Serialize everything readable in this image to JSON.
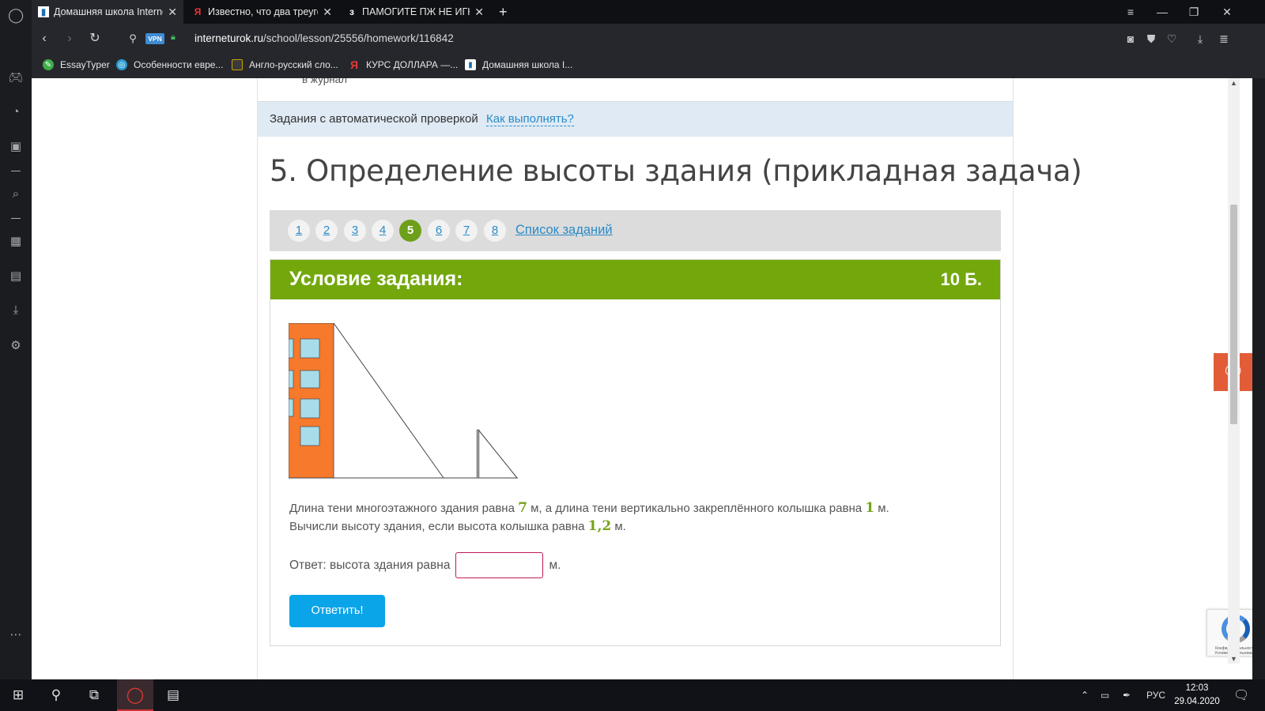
{
  "browser": {
    "tabs": [
      {
        "title": "Домашняя школа Interne",
        "favicon": "bookmark-icon",
        "active": true
      },
      {
        "title": "Известно, что два треугол",
        "favicon": "yandex-icon",
        "active": false
      },
      {
        "title": "ПАМОГИТЕ ПЖ НЕ ИГНОР",
        "favicon": "znanija-icon",
        "active": false
      }
    ],
    "favicon_letters": {
      "yandex": "Я",
      "znanija": "з"
    },
    "new_tab_label": "+",
    "vpn_label": "VPN",
    "url_domain": "interneturok.ru",
    "url_path": "/school/lesson/25556/homework/116842",
    "bookmarks": [
      {
        "label": "EssayTyper",
        "color": "#3fae49"
      },
      {
        "label": "Особенности евре...",
        "color": "#2b9bd1"
      },
      {
        "label": "Англо-русский сло...",
        "color": "#3a3a3a"
      },
      {
        "label": "КУРС ДОЛЛАРА —...",
        "color": "#e53935"
      },
      {
        "label": "Домашняя школа I...",
        "color": "#1e6fb4"
      }
    ]
  },
  "page": {
    "journal_text": "в журнал",
    "autocheck_label": "Задания с автоматической проверкой",
    "howto_link": "Как выполнять?",
    "lesson_title": "5. Определение высоты здания (прикладная задача)",
    "pager": {
      "pages": [
        "1",
        "2",
        "3",
        "4",
        "5",
        "6",
        "7",
        "8"
      ],
      "current": "5",
      "task_list_link": "Список заданий"
    },
    "task": {
      "header": "Условие задания:",
      "points": "10 Б.",
      "problem_line1_a": "Длина тени многоэтажного здания равна ",
      "shadow_building": "7",
      "problem_line1_b": " м, а длина тени вертикально закреплённого колышка равна ",
      "shadow_peg": "1",
      "problem_line1_c": " м.",
      "problem_line2_a": "Вычисли высоту здания, если высота колышка равна ",
      "peg_height": "1,2",
      "problem_line2_b": " м.",
      "answer_label": "Ответ: высота здания равна",
      "answer_value": "",
      "answer_unit": "м.",
      "submit_label": "Ответить!"
    },
    "captcha_text": "Конфиденциальность - Условия использования",
    "colors": {
      "accent_green": "#73a80c",
      "link_blue": "#2a8bc7",
      "button_blue": "#0aa4e8",
      "chat_orange": "#e35c38",
      "building_orange": "#f7792b",
      "window_blue": "#a8dcea"
    }
  },
  "taskbar": {
    "lang": "РУС",
    "time": "12:03",
    "date": "29.04.2020"
  }
}
